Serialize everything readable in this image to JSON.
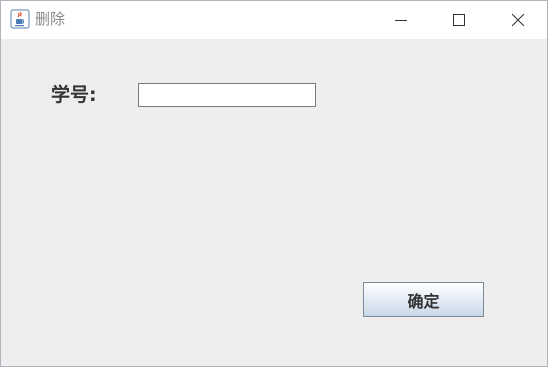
{
  "window": {
    "title": "删除",
    "icon": "java-coffee-cup-icon"
  },
  "titlebar_controls": {
    "minimize_icon": "minimize-icon",
    "maximize_icon": "maximize-icon",
    "close_icon": "close-icon"
  },
  "form": {
    "student_id_label": "学号:",
    "student_id_value": "",
    "student_id_placeholder": ""
  },
  "actions": {
    "confirm_label": "确定"
  },
  "colors": {
    "titlebar_bg": "#ffffff",
    "content_bg": "#eeeeee",
    "title_text": "#888888",
    "label_text": "#333333"
  }
}
